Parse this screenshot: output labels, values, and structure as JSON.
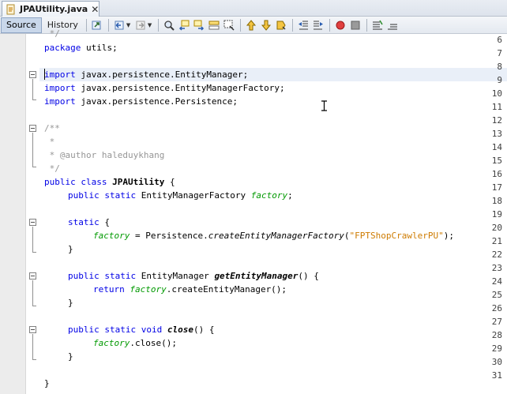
{
  "tab": {
    "title": "JPAUtility.java",
    "close": "✕"
  },
  "toolbar": {
    "source_label": "Source",
    "history_label": "History"
  },
  "editor": {
    "line_numbers": [
      "6",
      "7",
      "8",
      "9",
      "10",
      "11",
      "12",
      "13",
      "14",
      "15",
      "16",
      "17",
      "18",
      "19",
      "20",
      "21",
      "22",
      "23",
      "24",
      "25",
      "26",
      "27",
      "28",
      "29",
      "30",
      "31"
    ],
    "lines": {
      "l6_kw": "package",
      "l6_rest": " utils;",
      "l8_kw": "import",
      "l8_rest": " javax.persistence.EntityManager;",
      "l9_kw": "import",
      "l9_rest": " javax.persistence.EntityManagerFactory;",
      "l10_kw": "import",
      "l10_rest": " javax.persistence.Persistence;",
      "l12": "/**",
      "l13": " *",
      "l14": " * @author haleduykhang",
      "l15": " */",
      "l16_kw": "public class",
      "l16_name": "JPAUtility",
      "l16_rest": " {",
      "l17_kw": "public static",
      "l17_type": " EntityManagerFactory ",
      "l17_field": "factory",
      "l17_end": ";",
      "l19_kw": "static",
      "l19_rest": " {",
      "l20_field": "factory",
      "l20_mid": " = Persistence.",
      "l20_method": "createEntityManagerFactory",
      "l20_open": "(",
      "l20_str": "\"FPTShopCrawlerPU\"",
      "l20_end": ");",
      "l21": "}",
      "l23_kw": "public static",
      "l23_type": " EntityManager ",
      "l23_method": "getEntityManager",
      "l23_end": "() {",
      "l24_kw": "return",
      "l24_sp": " ",
      "l24_field": "factory",
      "l24_rest": ".createEntityManager();",
      "l25": "}",
      "l27_kw": "public static void",
      "l27_sp": " ",
      "l27_method": "close",
      "l27_end": "() {",
      "l28_field": "factory",
      "l28_rest": ".close();",
      "l29": "}",
      "l31": "}"
    }
  },
  "colors": {
    "keyword": "#0000e6",
    "comment": "#969696",
    "field": "#009900",
    "string": "#ce7b00",
    "current_line": "#e9eff8"
  },
  "icons": [
    "java-file-icon",
    "last-edit-icon",
    "back-icon",
    "forward-icon",
    "find-icon",
    "find-previous-icon",
    "find-next-icon",
    "toggle-highlight-icon",
    "find-selection-icon",
    "previous-bookmark-icon",
    "next-bookmark-icon",
    "toggle-bookmark-icon",
    "shift-left-icon",
    "shift-right-icon",
    "start-macro-icon",
    "stop-macro-icon",
    "comment-icon",
    "uncomment-icon"
  ]
}
